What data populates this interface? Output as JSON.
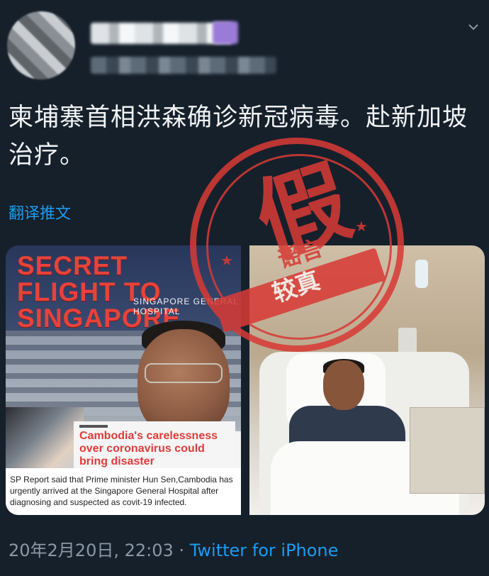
{
  "tweet": {
    "text": "柬埔寨首相洪森确诊新冠病毒。赴新加坡治疗。",
    "translate_link": "翻译推文"
  },
  "media": {
    "left": {
      "title": "SECRET FLIGHT TO SINGAPORE",
      "hospital_sign": "SINGAPORE GENERAL HOSPITAL",
      "headline": "Cambodia's carelessness over coronavirus could bring disaster",
      "caption": "SP Report said that Prime minister Hun Sen,Cambodia has urgently arrived at the Singapore General Hospital after diagnosing and suspected as covit-19 infected."
    },
    "stamp": {
      "main": "假",
      "sub": "谣言",
      "banner": "较真"
    }
  },
  "footer": {
    "timestamp": "20年2月20日, 22:03",
    "separator": "·",
    "source": "Twitter for iPhone"
  },
  "icons": {
    "caret": "chevron-down-icon"
  }
}
